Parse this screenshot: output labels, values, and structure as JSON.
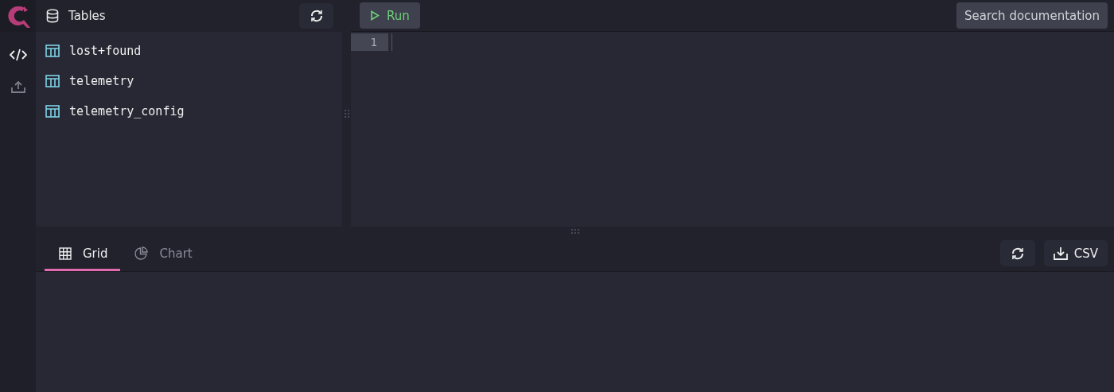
{
  "nav": [
    {
      "kind": "code",
      "selected": true
    },
    {
      "kind": "upload",
      "selected": false
    }
  ],
  "tables_panel": {
    "title": "Tables",
    "items": [
      "lost+found",
      "telemetry",
      "telemetry_config"
    ]
  },
  "toolbar": {
    "run": "Run",
    "search": "Search documentation"
  },
  "editor": {
    "line_numbers": [
      "1"
    ]
  },
  "result_tabs": [
    {
      "label": "Grid",
      "kind": "grid",
      "selected": true
    },
    {
      "label": "Chart",
      "kind": "chart",
      "selected": false
    }
  ],
  "result_actions": {
    "export": "CSV"
  }
}
